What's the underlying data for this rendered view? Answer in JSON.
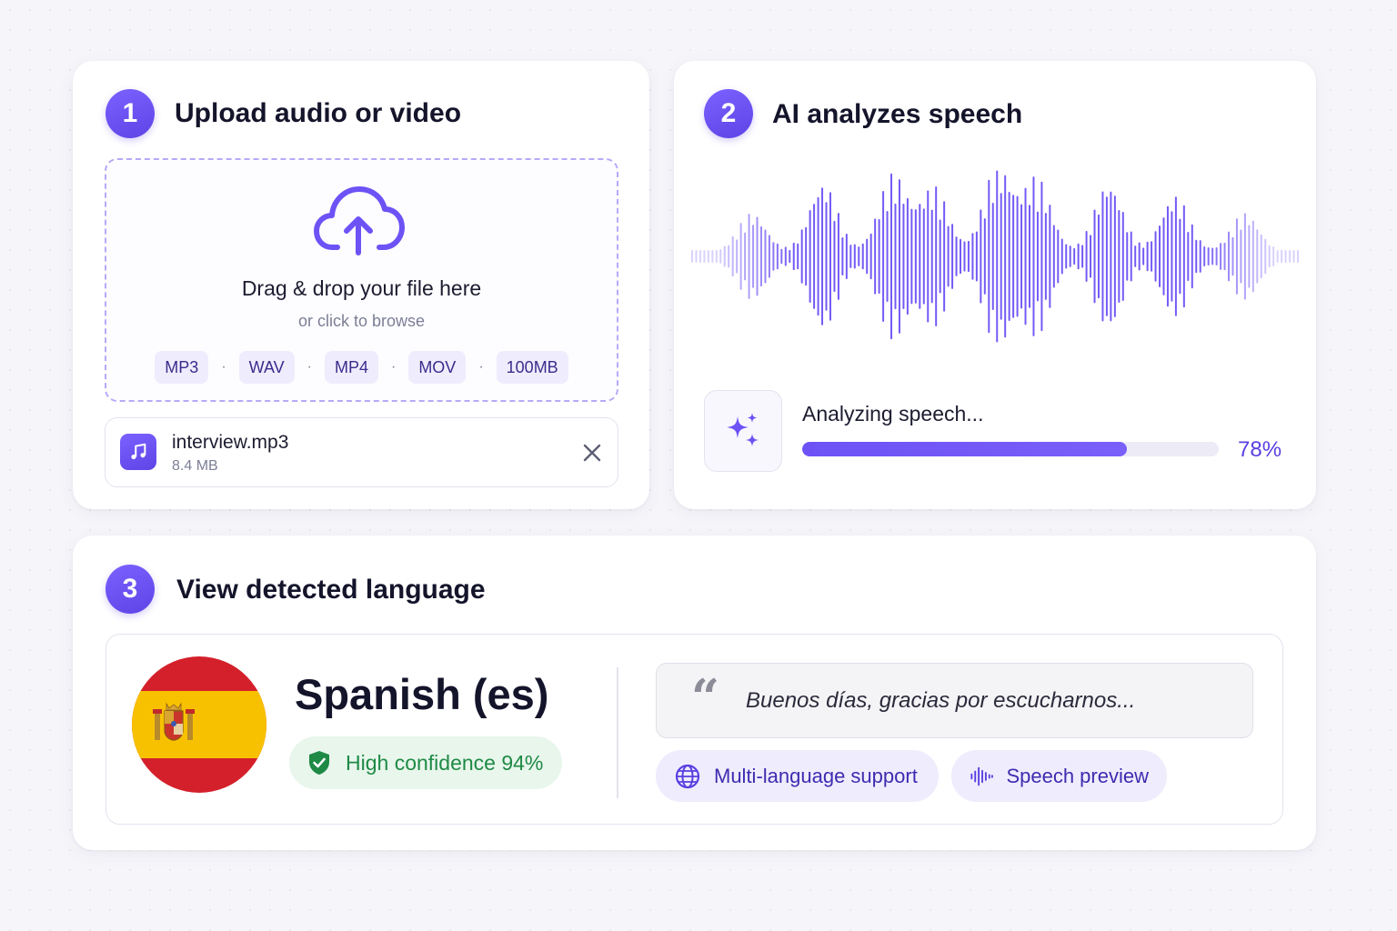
{
  "steps": {
    "upload": {
      "number": "1",
      "title": "Upload audio or video",
      "dropzone": {
        "main_text": "Drag & drop your file here",
        "sub_text": "or click to browse",
        "formats": [
          "MP3",
          "WAV",
          "MP4",
          "MOV",
          "100MB"
        ],
        "separator": "·"
      },
      "file": {
        "name": "interview.mp3",
        "size": "8.4 MB",
        "icon": "music-note-icon"
      }
    },
    "analyze": {
      "number": "2",
      "title": "AI analyzes speech",
      "status_label": "Analyzing speech...",
      "progress": 0.78,
      "progress_text": "78%",
      "icon": "sparkle-icon"
    },
    "result": {
      "number": "3",
      "title": "View detected language",
      "language": "Spanish (es)",
      "flag_icon": "spain-flag-icon",
      "confidence_text": "High confidence 94%",
      "quote_mark": "“",
      "quote": "Buenos días, gracias por escucharnos...",
      "features": [
        {
          "label": "Multi-language support",
          "icon": "globe-icon"
        },
        {
          "label": "Speech preview",
          "icon": "audio-wave-icon"
        }
      ]
    }
  },
  "colors": {
    "accent": "#6d52f5",
    "accent_light": "#efecfd",
    "success": "#1f8a45",
    "success_bg": "#e8f6ec",
    "flag_red": "#d4202b",
    "flag_yellow": "#f8c100"
  }
}
